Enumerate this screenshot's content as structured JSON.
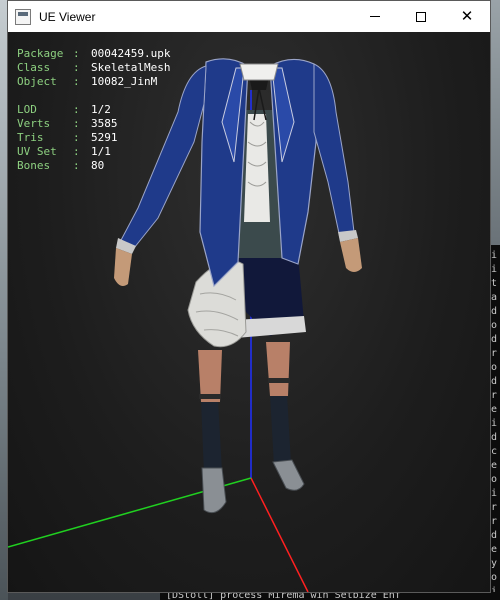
{
  "window": {
    "title": "UE Viewer",
    "controls": {
      "minimize": "minimize",
      "maximize": "maximize",
      "close": "close"
    }
  },
  "info_panel": {
    "group1": [
      {
        "label": "Package",
        "sep": ":",
        "value": "00042459.upk"
      },
      {
        "label": "Class",
        "sep": ":",
        "value": "SkeletalMesh"
      },
      {
        "label": "Object",
        "sep": ":",
        "value": "10082_JinM"
      }
    ],
    "group2": [
      {
        "label": "LOD",
        "sep": ":",
        "value": "1/2"
      },
      {
        "label": "Verts",
        "sep": ":",
        "value": "3585"
      },
      {
        "label": "Tris",
        "sep": ":",
        "value": "5291"
      },
      {
        "label": "UV Set",
        "sep": ":",
        "value": "1/1"
      },
      {
        "label": "Bones",
        "sep": ":",
        "value": "80"
      }
    ]
  },
  "console": {
    "bottom_line": "[DStoll] process  Mirema win Setbize  Enf",
    "glyphs": [
      "i",
      "i",
      "t",
      "a",
      "d",
      "o",
      "d",
      "r",
      "o",
      "d",
      "r",
      "e",
      "i",
      "d",
      "c",
      "e",
      "o",
      "i",
      "r",
      "r",
      "d",
      "e",
      "y",
      "o",
      "i"
    ]
  },
  "colors": {
    "axis_x": "#ff2020",
    "axis_y": "#20d020",
    "axis_z": "#2030ff",
    "info_label": "#8dd080",
    "info_value": "#ffffff"
  }
}
